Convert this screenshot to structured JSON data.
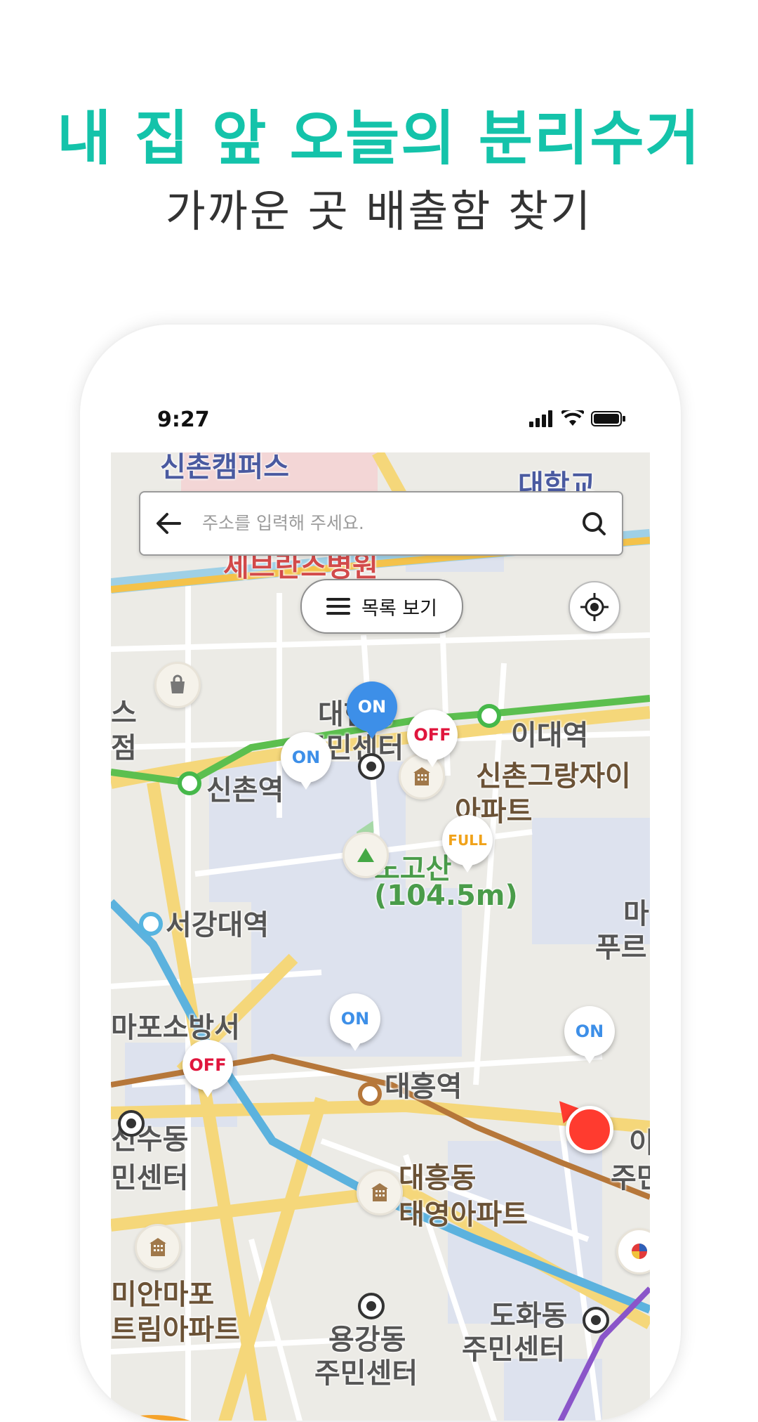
{
  "hero": {
    "headline": "내 집 앞 오늘의 분리수거",
    "subheadline": "가까운 곳 배출함 찾기"
  },
  "status_bar": {
    "time": "9:27",
    "icons": [
      "signal-icon",
      "wifi-icon",
      "battery-icon"
    ]
  },
  "search": {
    "placeholder": "주소를 입력해 주세요."
  },
  "controls": {
    "list_view_label": "목록 보기"
  },
  "pins": [
    {
      "status": "ON"
    },
    {
      "status": "OFF"
    },
    {
      "status": "ON"
    },
    {
      "status": "FULL"
    },
    {
      "status": "ON"
    },
    {
      "status": "ON"
    },
    {
      "status": "OFF"
    }
  ],
  "map_labels": {
    "sinchon_campus": "신촌캠퍼스",
    "university": "대학교",
    "severance": "세브란스병원",
    "daehyeon_dong": "대현동",
    "community_center": "주민센터",
    "idae_station": "이대역",
    "sinchon_grang": "신촌그랑자이",
    "apartment": "아파트",
    "sinchon_station": "신촌역",
    "s_left": "스",
    "jeom": "점",
    "nogosan": "노고산",
    "nogosan_height": "(104.5m)",
    "seogang_station": "서강대역",
    "ma": "마",
    "pureu": "푸르",
    "mapo_fire": "마포소방서",
    "daeheung_station": "대흥역",
    "sindong": "신수동",
    "minsenter": "민센터",
    "daeheung_dong": "대흥동",
    "taeyoung_apt": "태영아파트",
    "mian_mapo": "미안마포",
    "trim_apt": "트림아파트",
    "yonggang_dong": "용강동",
    "dohwa_dong": "도화동",
    "dohwa_center": "주민센터",
    "right_i": "이",
    "right_ju": "주민",
    "yonggang_center": "주민센터"
  },
  "colors": {
    "brand": "#14c3aa",
    "on": "#3d8fe8",
    "off": "#e0163d",
    "full": "#f0a21a"
  }
}
